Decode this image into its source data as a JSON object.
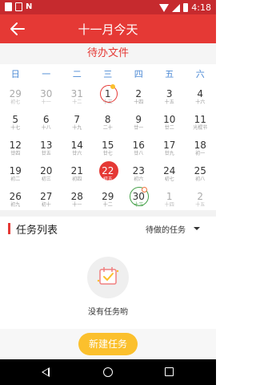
{
  "status_bar": {
    "time": "4:18",
    "icons": [
      "notification-icon",
      "sim-icon",
      "n-icon",
      "wifi-icon",
      "signal-icon",
      "battery-icon"
    ]
  },
  "app_bar": {
    "title": "十一月今天",
    "back_icon": "arrow-left-icon"
  },
  "subtitle": "待办文件",
  "weekdays": [
    "日",
    "一",
    "二",
    "三",
    "四",
    "五",
    "六"
  ],
  "calendar": [
    [
      {
        "d": "29",
        "l": "初七",
        "other": true
      },
      {
        "d": "30",
        "l": "十一",
        "other": true
      },
      {
        "d": "31",
        "l": "十二",
        "other": true
      },
      {
        "d": "1",
        "l": "十三",
        "today": true,
        "mark": "yellow"
      },
      {
        "d": "2",
        "l": "十四"
      },
      {
        "d": "3",
        "l": "十五"
      },
      {
        "d": "4",
        "l": "十六"
      }
    ],
    [
      {
        "d": "5",
        "l": "十七"
      },
      {
        "d": "6",
        "l": "十八"
      },
      {
        "d": "7",
        "l": "十九"
      },
      {
        "d": "8",
        "l": "二十"
      },
      {
        "d": "9",
        "l": "廿一"
      },
      {
        "d": "10",
        "l": "廿二"
      },
      {
        "d": "11",
        "l": "光棍节"
      }
    ],
    [
      {
        "d": "12",
        "l": "廿四"
      },
      {
        "d": "13",
        "l": "廿五"
      },
      {
        "d": "14",
        "l": "廿六"
      },
      {
        "d": "15",
        "l": "廿七"
      },
      {
        "d": "16",
        "l": "廿八"
      },
      {
        "d": "17",
        "l": "廿九"
      },
      {
        "d": "18",
        "l": "初一"
      }
    ],
    [
      {
        "d": "19",
        "l": "初二"
      },
      {
        "d": "20",
        "l": "初三"
      },
      {
        "d": "21",
        "l": "初四"
      },
      {
        "d": "22",
        "l": "初五",
        "selected": true
      },
      {
        "d": "23",
        "l": "初六"
      },
      {
        "d": "24",
        "l": "初七"
      },
      {
        "d": "25",
        "l": "初八"
      }
    ],
    [
      {
        "d": "26",
        "l": "初九"
      },
      {
        "d": "27",
        "l": "初十"
      },
      {
        "d": "28",
        "l": "十一"
      },
      {
        "d": "29",
        "l": "十二"
      },
      {
        "d": "30",
        "l": "十三",
        "green": true,
        "mark": "orange"
      },
      {
        "d": "1",
        "l": "十四",
        "other": true
      },
      {
        "d": "2",
        "l": "十五",
        "other": true
      }
    ]
  ],
  "tasks": {
    "title": "任务列表",
    "filter_label": "待做的任务",
    "empty_text": "没有任务哟",
    "empty_icon": "calendar-check-icon"
  },
  "new_task_button": "新建任务",
  "colors": {
    "primary": "#e53935",
    "status_bar": "#c62a2e",
    "weekday": "#4a88d4",
    "accent_yellow": "#fbc02d",
    "green": "#43a047"
  }
}
